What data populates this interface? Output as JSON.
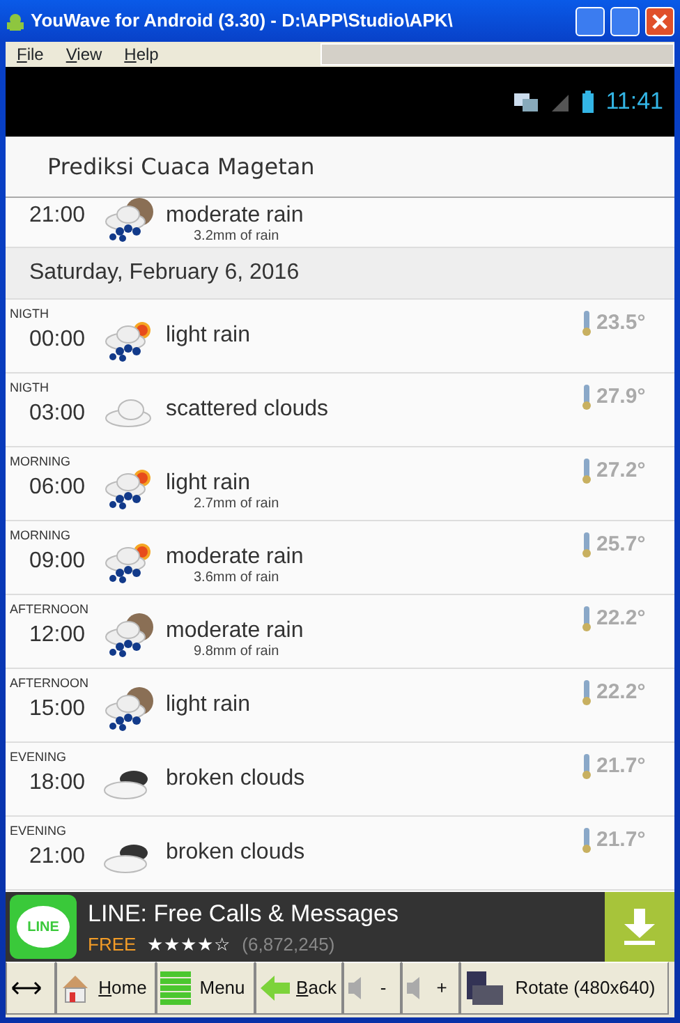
{
  "window": {
    "title": "YouWave for Android (3.30) - D:\\APP\\Studio\\APK\\"
  },
  "menu": [
    {
      "label": "File",
      "mnemonic": true
    },
    {
      "label": "View",
      "mnemonic": true
    },
    {
      "label": "Help",
      "mnemonic": true
    }
  ],
  "status_bar": {
    "time": "11:41"
  },
  "app": {
    "title": "Prediksi Cuaca Magetan"
  },
  "partial_row": {
    "time": "21:00",
    "kind": "rain-moon",
    "description": "moderate rain",
    "rain": "3.2mm of rain"
  },
  "date_header": "Saturday, February 6, 2016",
  "rows": [
    {
      "period": "NIGTH",
      "time": "00:00",
      "kind": "rain-sun",
      "description": "light rain",
      "temperature": "23.5°"
    },
    {
      "period": "NIGTH",
      "time": "03:00",
      "kind": "cloud",
      "description": "scattered clouds",
      "temperature": "27.9°"
    },
    {
      "period": "MORNING",
      "time": "06:00",
      "kind": "rain-sun",
      "description": "light rain",
      "rain": "2.7mm of rain",
      "temperature": "27.2°"
    },
    {
      "period": "MORNING",
      "time": "09:00",
      "kind": "rain-sun",
      "description": "moderate rain",
      "rain": "3.6mm of rain",
      "temperature": "25.7°"
    },
    {
      "period": "AFTERNOON",
      "time": "12:00",
      "kind": "rain-moon",
      "description": "moderate rain",
      "rain": "9.8mm of rain",
      "temperature": "22.2°"
    },
    {
      "period": "AFTERNOON",
      "time": "15:00",
      "kind": "rain-moon",
      "description": "light rain",
      "temperature": "22.2°"
    },
    {
      "period": "EVENING",
      "time": "18:00",
      "kind": "dark-cloud",
      "description": "broken clouds",
      "temperature": "21.7°"
    },
    {
      "period": "EVENING",
      "time": "21:00",
      "kind": "dark-cloud",
      "description": "broken clouds",
      "temperature": "21.7°"
    }
  ],
  "ad": {
    "logo": "LINE",
    "title": "LINE: Free Calls & Messages",
    "price": "FREE",
    "stars": 4,
    "reviews": "(6,872,245)"
  },
  "toolbar": [
    {
      "kind": "resize"
    },
    {
      "kind": "home",
      "label": "Home",
      "mnemonic": true
    },
    {
      "kind": "menu",
      "label": "Menu",
      "mnemonic": false
    },
    {
      "kind": "back",
      "label": "Back",
      "mnemonic": true
    },
    {
      "kind": "volume",
      "label": "-",
      "mnemonic": false
    },
    {
      "kind": "volume",
      "label": "+",
      "mnemonic": false
    },
    {
      "kind": "rotate",
      "label": "Rotate (480x640)",
      "mnemonic": false
    }
  ]
}
